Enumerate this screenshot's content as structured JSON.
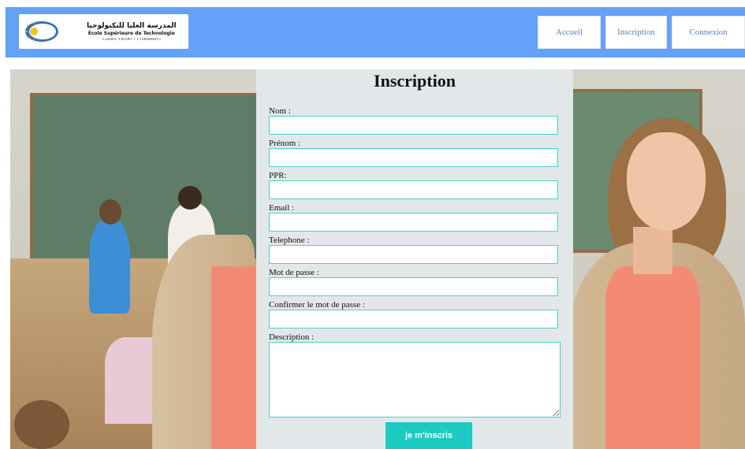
{
  "header": {
    "logo": {
      "arabic": "المدرسة العليا للتكنولوجيا",
      "french": "École Supérieure de Technologie",
      "tifinagh": "ⵜⴰⵙⵏⵓⵏⵜ ⵜⵓⵏⵏⵉⴳⵜ ⵏ ⵜⵜⵉⴽⵏⵓⵍⵓⵊⵢⴰ"
    },
    "nav": [
      "Accueil",
      "Inscription",
      "Connexion"
    ]
  },
  "form": {
    "title": "Inscription",
    "fields": [
      {
        "label": "Nom :",
        "value": ""
      },
      {
        "label": "Prénom :",
        "value": ""
      },
      {
        "label": "PPR:",
        "value": ""
      },
      {
        "label": "Email :",
        "value": ""
      },
      {
        "label": "Telephone :",
        "value": ""
      },
      {
        "label": "Mot de passe :",
        "value": ""
      },
      {
        "label": "Confirmer le mot de passe :",
        "value": ""
      }
    ],
    "description_label": "Description :",
    "submit_label": "je m'inscris"
  },
  "colors": {
    "header_bg": "#64a1f9",
    "nav_text": "#4f7fd0",
    "panel_bg": "#e2e8e9",
    "input_border": "#45d2cb",
    "button_bg": "#1ccbc1"
  },
  "icons": [
    "school-logo-emblem",
    "textarea-resize-handle-icon"
  ]
}
